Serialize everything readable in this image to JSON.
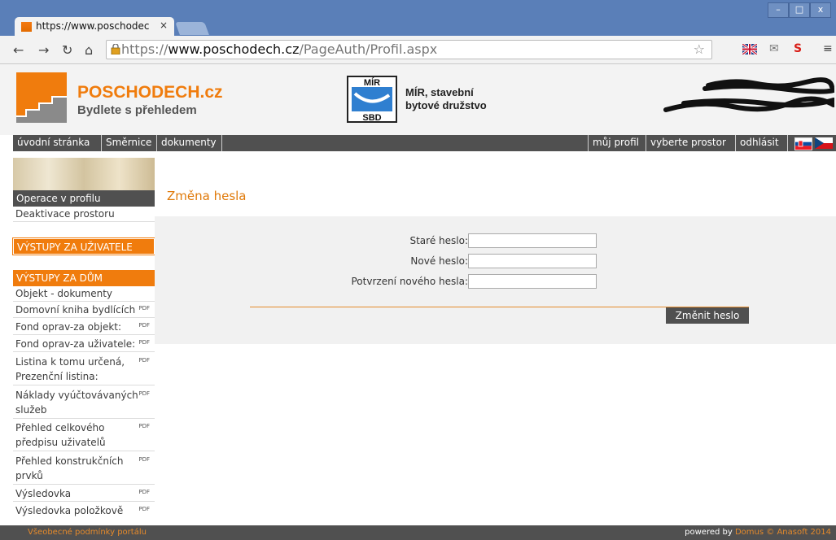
{
  "browser": {
    "tab_title": "https://www.poschodec",
    "tab_close": "×",
    "url_prefix": "https://",
    "url_domain": "www.poschodech.cz",
    "url_path": "/PageAuth/Profil.aspx",
    "window_controls": [
      "–",
      "□",
      "x"
    ]
  },
  "header": {
    "brand_name": "POSCHODECH.cz",
    "brand_tagline": "Bydlete s přehledem",
    "coop_logo_top": "MÍR",
    "coop_logo_bottom": "SBD",
    "coop_name_line1": "MÍR, stavební",
    "coop_name_line2": "bytové družstvo"
  },
  "topnav": {
    "left": [
      "úvodní stránka",
      "Směrnice",
      "dokumenty"
    ],
    "right": [
      "můj profil",
      "vyberte prostor",
      "odhlásit"
    ]
  },
  "sidebar": {
    "profile_header": "Operace v profilu",
    "profile_links": [
      "Deaktivace prostoru"
    ],
    "section_user": "VÝSTUPY ZA UŽIVATELE",
    "section_house": "VÝSTUPY ZA DŮM",
    "house_links": [
      {
        "label": "Objekt - dokumenty",
        "pdf": ""
      },
      {
        "label": "Domovní kniha bydlících",
        "pdf": "PDF"
      },
      {
        "label": "Fond oprav-za objekt:",
        "pdf": "PDF"
      },
      {
        "label": "Fond oprav-za uživatele:",
        "pdf": "PDF"
      },
      {
        "label": "Listina k tomu určená,",
        "label2": "Prezenční listina:",
        "pdf": "PDF"
      },
      {
        "label": "Náklady vyúčtovávaných",
        "label2": "služeb",
        "pdf": "PDF"
      },
      {
        "label": "Přehled celkového",
        "label2": "předpisu uživatelů",
        "pdf": "PDF"
      },
      {
        "label": "Přehled konstrukčních",
        "label2": "prvků",
        "pdf": "PDF"
      },
      {
        "label": "Výsledovka",
        "pdf": "PDF"
      },
      {
        "label": "Výsledovka položkově",
        "pdf": "PDF"
      }
    ]
  },
  "main": {
    "title": "Změna hesla",
    "old_password_label": "Staré heslo:",
    "new_password_label": "Nové heslo:",
    "confirm_password_label": "Potvrzení nového hesla:",
    "submit_label": "Změnit heslo"
  },
  "footer": {
    "left": "Všeobecné podmínky portálu",
    "powered_by": "powered by",
    "product": "Domus",
    "copyright": "© Anasoft 2014"
  },
  "colors": {
    "accent": "#f07c0d",
    "nav_bg": "#505050",
    "tabstrip": "#5a7fb8"
  }
}
